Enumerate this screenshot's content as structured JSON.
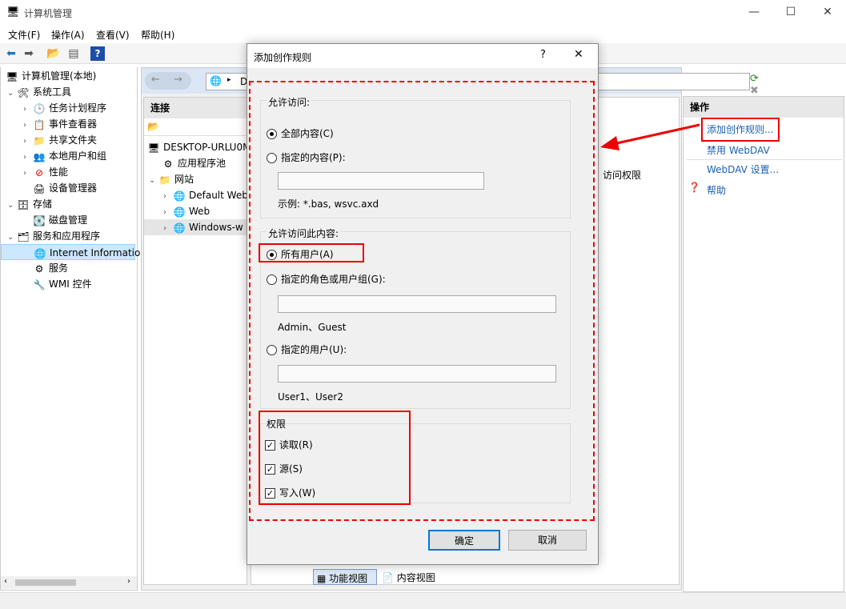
{
  "window": {
    "title": "计算机管理",
    "min": "—",
    "max": "☐",
    "close": "✕"
  },
  "menu": [
    "文件(F)",
    "操作(A)",
    "查看(V)",
    "帮助(H)"
  ],
  "tree": {
    "root": "计算机管理(本地)",
    "system_tools": "系统工具",
    "task_scheduler": "任务计划程序",
    "event_viewer": "事件查看器",
    "shared_folders": "共享文件夹",
    "local_users": "本地用户和组",
    "performance": "性能",
    "device_manager": "设备管理器",
    "storage": "存储",
    "disk_management": "磁盘管理",
    "services_apps": "服务和应用程序",
    "iis": "Internet Informatio",
    "services": "服务",
    "wmi": "WMI 控件"
  },
  "iis": {
    "address_text": "D",
    "connections_header": "连接",
    "host": "DESKTOP-URLU0M",
    "app_pools": "应用程序池",
    "sites": "网站",
    "site1": "Default Web",
    "site2": "Web",
    "site3": "Windows-w",
    "column_header": "访问权限",
    "feature_view": "功能视图",
    "content_view": "内容视图"
  },
  "actions": {
    "header": "操作",
    "add_rule": "添加创作规则...",
    "disable_webdav": "禁用 WebDAV",
    "webdav_settings": "WebDAV 设置...",
    "help": "帮助"
  },
  "dialog": {
    "title": "添加创作规则",
    "help_btn": "?",
    "close_btn": "✕",
    "allow_access_label": "允许访问:",
    "all_content": "全部内容(C)",
    "specified_content": "指定的内容(P):",
    "specified_content_value": "",
    "example": "示例: *.bas, wsvc.axd",
    "allow_content_label": "允许访问此内容:",
    "all_users": "所有用户(A)",
    "roles": "指定的角色或用户组(G):",
    "roles_value": "",
    "roles_example": "Admin、Guest",
    "users": "指定的用户(U):",
    "users_value": "",
    "users_example": "User1、User2",
    "permissions_label": "权限",
    "read": "读取(R)",
    "source": "源(S)",
    "write": "写入(W)",
    "ok": "确定",
    "cancel": "取消"
  },
  "colors": {
    "highlight": "#e00000",
    "link": "#1a5fb4",
    "selection": "#cce8ff"
  }
}
